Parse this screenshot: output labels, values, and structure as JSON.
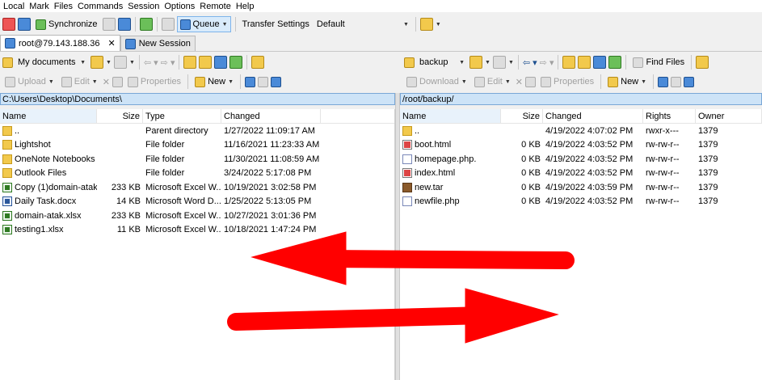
{
  "menu": [
    "Local",
    "Mark",
    "Files",
    "Commands",
    "Session",
    "Options",
    "Remote",
    "Help"
  ],
  "toolbar": {
    "synchronize": "Synchronize",
    "queue": "Queue",
    "transfer_settings_label": "Transfer Settings",
    "transfer_settings_value": "Default"
  },
  "tabs": [
    {
      "label": "root@79.143.188.36"
    },
    {
      "label": "New Session"
    }
  ],
  "local": {
    "location": "My documents",
    "upload": "Upload",
    "edit": "Edit",
    "properties": "Properties",
    "new": "New",
    "path": "C:\\Users\\Desktop\\Documents\\",
    "columns": {
      "name": "Name",
      "size": "Size",
      "type": "Type",
      "changed": "Changed"
    },
    "rows": [
      {
        "name": "..",
        "size": "",
        "type": "Parent directory",
        "changed": "1/27/2022  11:09:17 AM",
        "icon": "up"
      },
      {
        "name": "Lightshot",
        "size": "",
        "type": "File folder",
        "changed": "11/16/2021  11:23:33 AM",
        "icon": "folder"
      },
      {
        "name": "OneNote Notebooks",
        "size": "",
        "type": "File folder",
        "changed": "11/30/2021  11:08:59 AM",
        "icon": "folder"
      },
      {
        "name": "Outlook Files",
        "size": "",
        "type": "File folder",
        "changed": "3/24/2022  5:17:08 PM",
        "icon": "folder"
      },
      {
        "name": "Copy (1)domain-atak...",
        "size": "233 KB",
        "type": "Microsoft Excel W...",
        "changed": "10/19/2021  3:02:58 PM",
        "icon": "xls"
      },
      {
        "name": "Daily Task.docx",
        "size": "14 KB",
        "type": "Microsoft Word D...",
        "changed": "1/25/2022  5:13:05 PM",
        "icon": "doc"
      },
      {
        "name": "domain-atak.xlsx",
        "size": "233 KB",
        "type": "Microsoft Excel W...",
        "changed": "10/27/2021  3:01:36 PM",
        "icon": "xls"
      },
      {
        "name": "testing1.xlsx",
        "size": "11 KB",
        "type": "Microsoft Excel W...",
        "changed": "10/18/2021  1:47:24 PM",
        "icon": "xls"
      }
    ]
  },
  "remote": {
    "location": "backup",
    "download": "Download",
    "edit": "Edit",
    "properties": "Properties",
    "new": "New",
    "find_files": "Find Files",
    "path": "/root/backup/",
    "columns": {
      "name": "Name",
      "size": "Size",
      "changed": "Changed",
      "rights": "Rights",
      "owner": "Owner"
    },
    "rows": [
      {
        "name": "..",
        "size": "",
        "changed": "4/19/2022 4:07:02 PM",
        "rights": "rwxr-x---",
        "owner": "1379",
        "icon": "up"
      },
      {
        "name": "boot.html",
        "size": "0 KB",
        "changed": "4/19/2022 4:03:52 PM",
        "rights": "rw-rw-r--",
        "owner": "1379",
        "icon": "html"
      },
      {
        "name": "homepage.php.",
        "size": "0 KB",
        "changed": "4/19/2022 4:03:52 PM",
        "rights": "rw-rw-r--",
        "owner": "1379",
        "icon": "php"
      },
      {
        "name": "index.html",
        "size": "0 KB",
        "changed": "4/19/2022 4:03:52 PM",
        "rights": "rw-rw-r--",
        "owner": "1379",
        "icon": "html"
      },
      {
        "name": "new.tar",
        "size": "0 KB",
        "changed": "4/19/2022 4:03:59 PM",
        "rights": "rw-rw-r--",
        "owner": "1379",
        "icon": "tar"
      },
      {
        "name": "newfile.php",
        "size": "0 KB",
        "changed": "4/19/2022 4:03:52 PM",
        "rights": "rw-rw-r--",
        "owner": "1379",
        "icon": "php"
      }
    ]
  },
  "annotation_color": "#ff0000"
}
